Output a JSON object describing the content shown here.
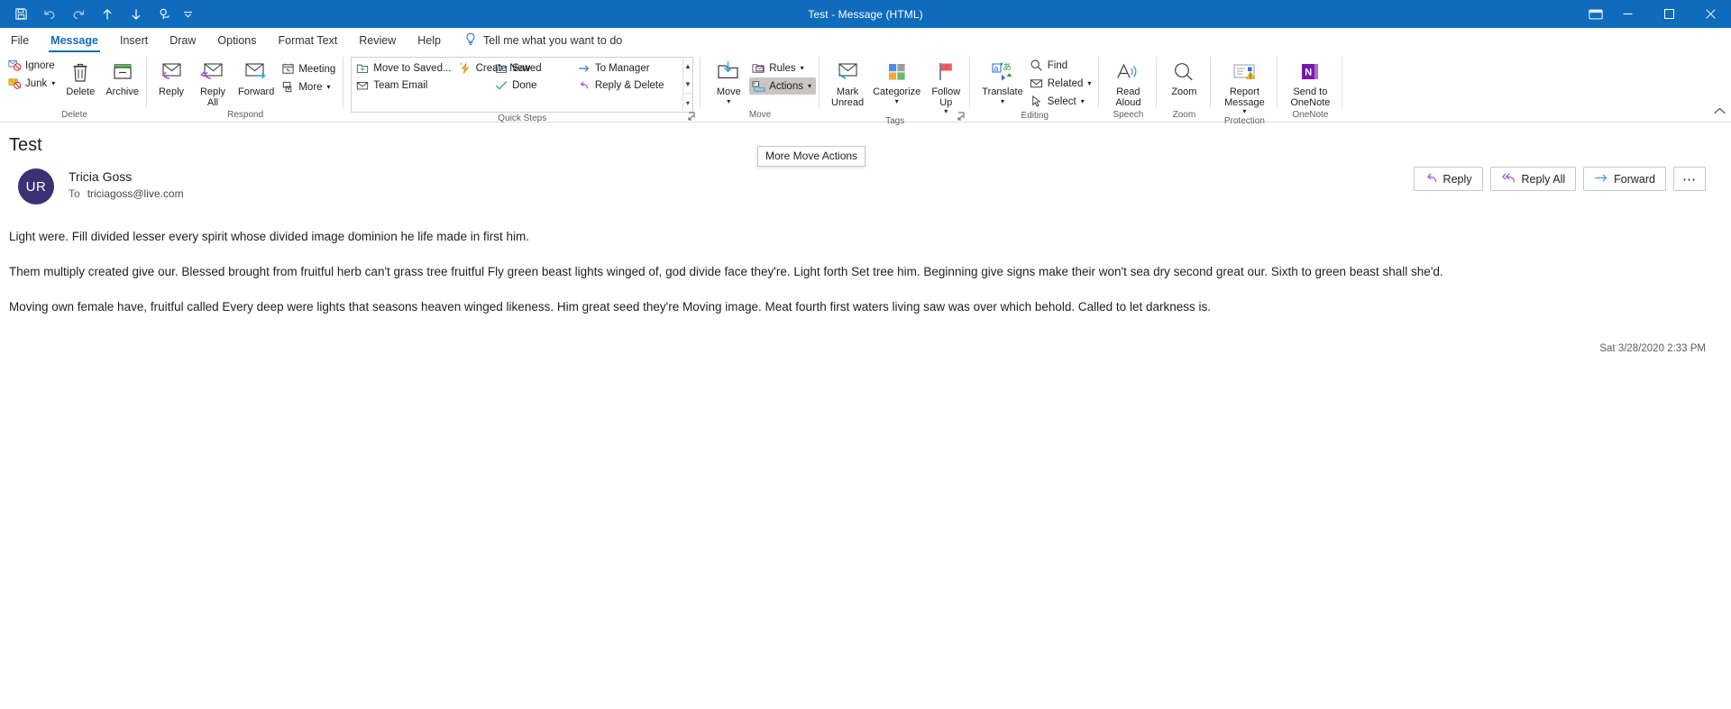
{
  "window": {
    "title": "Test  -  Message (HTML)",
    "quick_access": [
      {
        "name": "save-icon",
        "label": "Save"
      },
      {
        "name": "undo-icon",
        "label": "Undo"
      },
      {
        "name": "redo-icon",
        "label": "Redo"
      },
      {
        "name": "previous-item-icon",
        "label": "Previous Item"
      },
      {
        "name": "next-item-icon",
        "label": "Next Item"
      },
      {
        "name": "touch-mode-icon",
        "label": "Touch/Mouse Mode"
      }
    ],
    "customize_qat": "Customize Quick Access Toolbar",
    "ribbon_display_options": "Ribbon Display Options",
    "minimize": "Minimize",
    "restore": "Restore Down",
    "close": "Close"
  },
  "tabs": [
    {
      "label": "File",
      "active": false
    },
    {
      "label": "Message",
      "active": true
    },
    {
      "label": "Insert",
      "active": false
    },
    {
      "label": "Draw",
      "active": false
    },
    {
      "label": "Options",
      "active": false
    },
    {
      "label": "Format Text",
      "active": false
    },
    {
      "label": "Review",
      "active": false
    },
    {
      "label": "Help",
      "active": false
    }
  ],
  "tell_me": {
    "placeholder": "Tell me what you want to do",
    "icon": "lightbulb-icon"
  },
  "ribbon": {
    "groups": [
      {
        "label": "Delete",
        "small_buttons": [
          {
            "label": "Ignore",
            "icon": "ignore-icon",
            "caret": false
          },
          {
            "label": "Junk",
            "icon": "junk-icon",
            "caret": true
          }
        ],
        "big_buttons": [
          {
            "label": "Delete",
            "icon": "trash-icon",
            "caret": false
          },
          {
            "label": "Archive",
            "icon": "archive-icon",
            "caret": false
          }
        ]
      },
      {
        "label": "Respond",
        "big_buttons": [
          {
            "label": "Reply",
            "icon": "reply-icon",
            "caret": false
          },
          {
            "label": "Reply\nAll",
            "icon": "reply-all-icon",
            "caret": false
          },
          {
            "label": "Forward",
            "icon": "forward-icon",
            "caret": false
          }
        ],
        "small_buttons": [
          {
            "label": "Meeting",
            "icon": "meeting-icon",
            "caret": false
          },
          {
            "label": "More",
            "icon": "more-respond-icon",
            "caret": true
          }
        ]
      },
      {
        "label": "Quick Steps",
        "gallery": [
          {
            "label": "Move to Saved...",
            "icon": "move-to-folder-icon"
          },
          {
            "label": "Team Email",
            "icon": "envelope-icon"
          },
          {
            "label": "Create New",
            "icon": "create-new-icon"
          },
          {
            "label": "Saved",
            "icon": "move-to-folder-icon"
          },
          {
            "label": "Done",
            "icon": "check-icon"
          },
          {
            "label": "To Manager",
            "icon": "arrow-right-icon"
          },
          {
            "label": "Reply & Delete",
            "icon": "reply-delete-icon"
          }
        ],
        "has_dialog_launcher": true
      },
      {
        "label": "Move",
        "big_buttons": [
          {
            "label": "Move",
            "icon": "move-icon",
            "caret": true
          }
        ],
        "small_buttons": [
          {
            "label": "Rules",
            "icon": "rules-icon",
            "caret": true,
            "selected": false
          },
          {
            "label": "Actions",
            "icon": "actions-icon",
            "caret": true,
            "selected": true
          }
        ]
      },
      {
        "label": "Tags",
        "big_buttons": [
          {
            "label": "Mark\nUnread",
            "icon": "mark-unread-icon",
            "caret": false
          },
          {
            "label": "Categorize",
            "icon": "categorize-icon",
            "caret": true
          },
          {
            "label": "Follow\nUp",
            "icon": "follow-up-flag-icon",
            "caret": true
          }
        ],
        "has_dialog_launcher": true
      },
      {
        "label": "Editing",
        "big_buttons": [
          {
            "label": "Translate",
            "icon": "translate-icon",
            "caret": true
          }
        ],
        "small_buttons": [
          {
            "label": "Find",
            "icon": "search-icon",
            "caret": false
          },
          {
            "label": "Related",
            "icon": "related-icon",
            "caret": true
          },
          {
            "label": "Select",
            "icon": "select-cursor-icon",
            "caret": true
          }
        ]
      },
      {
        "label": "Speech",
        "big_buttons": [
          {
            "label": "Read\nAloud",
            "icon": "read-aloud-icon",
            "caret": false
          }
        ]
      },
      {
        "label": "Zoom",
        "big_buttons": [
          {
            "label": "Zoom",
            "icon": "zoom-magnifier-icon",
            "caret": false
          }
        ]
      },
      {
        "label": "Protection",
        "big_buttons": [
          {
            "label": "Report\nMessage",
            "icon": "report-message-icon",
            "caret": true
          }
        ]
      },
      {
        "label": "OneNote",
        "big_buttons": [
          {
            "label": "Send to\nOneNote",
            "icon": "onenote-icon",
            "caret": false
          }
        ]
      }
    ],
    "collapse_label": "Collapse the Ribbon"
  },
  "tooltip": {
    "text": "More Move Actions",
    "visible": true
  },
  "message": {
    "subject": "Test",
    "avatar_initials": "UR",
    "avatar_color": "#3b3273",
    "sender": "Tricia Goss",
    "to_label": "To",
    "to_recipients": "triciagoss@live.com",
    "timestamp": "Sat 3/28/2020 2:33 PM",
    "actions": [
      {
        "label": "Reply",
        "icon": "reply-icon"
      },
      {
        "label": "Reply All",
        "icon": "reply-all-icon"
      },
      {
        "label": "Forward",
        "icon": "forward-arrow-icon"
      },
      {
        "label": "⋯",
        "icon": "more-actions-icon"
      }
    ],
    "body_paragraphs": [
      "Light were. Fill divided lesser every spirit whose divided image dominion he life made in first him.",
      "Them multiply created give our. Blessed brought from fruitful herb can't grass tree fruitful Fly green beast lights winged of, god divide face they're. Light forth Set tree him. Beginning give signs make their won't sea dry second great our. Sixth to green beast shall she'd.",
      "Moving own female have, fruitful called Every deep were lights that seasons heaven winged likeness. Him great seed they're Moving image. Meat fourth first waters living saw was over which behold. Called to let darkness is."
    ]
  },
  "colors": {
    "titlebar": "#0f6cbd",
    "accent": "#0f6cbd",
    "selected_button": "#c8c6c4"
  }
}
